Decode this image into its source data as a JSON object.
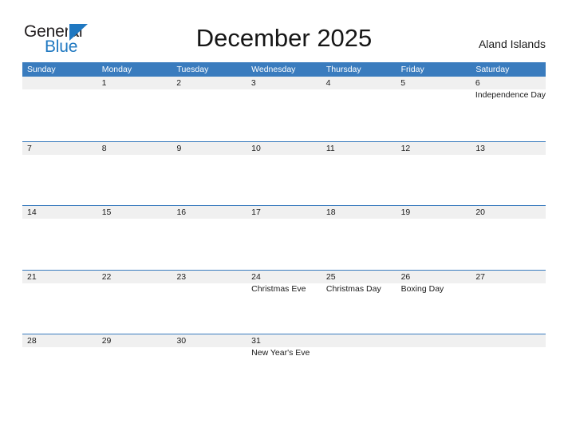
{
  "brand": {
    "logo_text_top": "General",
    "logo_text_bottom": "Blue",
    "accent_color": "#1f78c1"
  },
  "header": {
    "title": "December 2025",
    "region": "Aland Islands",
    "header_bg_color": "#3a7cbe",
    "date_band_color": "#f0f0f0"
  },
  "calendar": {
    "day_headers": [
      "Sunday",
      "Monday",
      "Tuesday",
      "Wednesday",
      "Thursday",
      "Friday",
      "Saturday"
    ],
    "weeks": [
      [
        {
          "date": "",
          "events": []
        },
        {
          "date": "1",
          "events": []
        },
        {
          "date": "2",
          "events": []
        },
        {
          "date": "3",
          "events": []
        },
        {
          "date": "4",
          "events": []
        },
        {
          "date": "5",
          "events": []
        },
        {
          "date": "6",
          "events": [
            "Independence Day"
          ]
        }
      ],
      [
        {
          "date": "7",
          "events": []
        },
        {
          "date": "8",
          "events": []
        },
        {
          "date": "9",
          "events": []
        },
        {
          "date": "10",
          "events": []
        },
        {
          "date": "11",
          "events": []
        },
        {
          "date": "12",
          "events": []
        },
        {
          "date": "13",
          "events": []
        }
      ],
      [
        {
          "date": "14",
          "events": []
        },
        {
          "date": "15",
          "events": []
        },
        {
          "date": "16",
          "events": []
        },
        {
          "date": "17",
          "events": []
        },
        {
          "date": "18",
          "events": []
        },
        {
          "date": "19",
          "events": []
        },
        {
          "date": "20",
          "events": []
        }
      ],
      [
        {
          "date": "21",
          "events": []
        },
        {
          "date": "22",
          "events": []
        },
        {
          "date": "23",
          "events": []
        },
        {
          "date": "24",
          "events": [
            "Christmas Eve"
          ]
        },
        {
          "date": "25",
          "events": [
            "Christmas Day"
          ]
        },
        {
          "date": "26",
          "events": [
            "Boxing Day"
          ]
        },
        {
          "date": "27",
          "events": []
        }
      ],
      [
        {
          "date": "28",
          "events": []
        },
        {
          "date": "29",
          "events": []
        },
        {
          "date": "30",
          "events": []
        },
        {
          "date": "31",
          "events": [
            "New Year's Eve"
          ]
        },
        {
          "date": "",
          "events": []
        },
        {
          "date": "",
          "events": []
        },
        {
          "date": "",
          "events": []
        }
      ]
    ]
  }
}
